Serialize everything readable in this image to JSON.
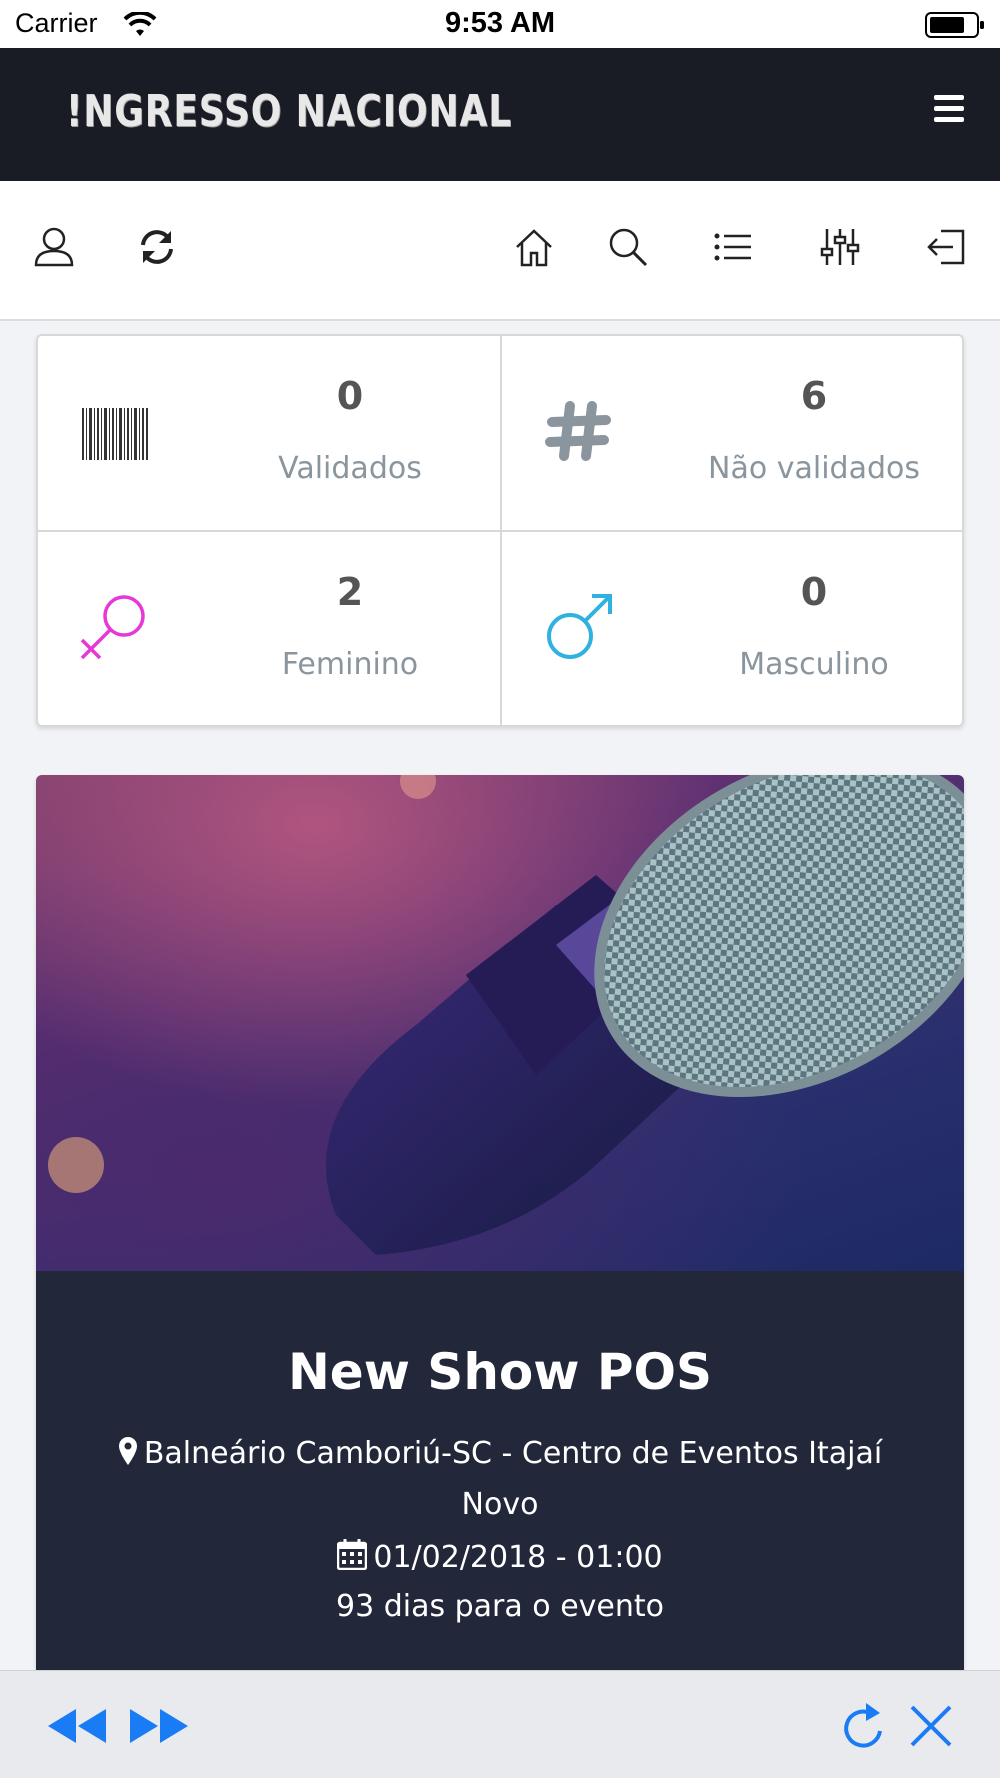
{
  "status_bar": {
    "carrier": "Carrier",
    "time": "9:53 AM"
  },
  "header": {
    "logo_text": "!NGRESSO NACIONAL",
    "menu_icon": "hamburger-icon"
  },
  "toolbar": {
    "left_icons": [
      "user-icon",
      "refresh-icon"
    ],
    "right_icons": [
      "home-icon",
      "search-icon",
      "list-icon",
      "sliders-icon",
      "logout-icon"
    ]
  },
  "stats": [
    {
      "value": "0",
      "label": "Validados",
      "icon": "barcode-icon"
    },
    {
      "value": "6",
      "label": "Não validados",
      "icon": "hashtag-icon"
    },
    {
      "value": "2",
      "label": "Feminino",
      "icon": "female-icon",
      "color": "#e637d9"
    },
    {
      "value": "0",
      "label": "Masculino",
      "icon": "male-icon",
      "color": "#2fb2e0"
    }
  ],
  "event": {
    "image": "microphone-image",
    "title": "New Show POS",
    "location": "Balneário Camboriú-SC - Centro de Eventos Itajaí",
    "status": "Novo",
    "datetime": "01/02/2018 - 01:00",
    "countdown": "93 dias para o evento"
  },
  "bottom_bar": {
    "buttons": [
      "back-icon",
      "forward-icon",
      "reload-icon",
      "close-icon"
    ],
    "accent": "#1a7cf5"
  }
}
